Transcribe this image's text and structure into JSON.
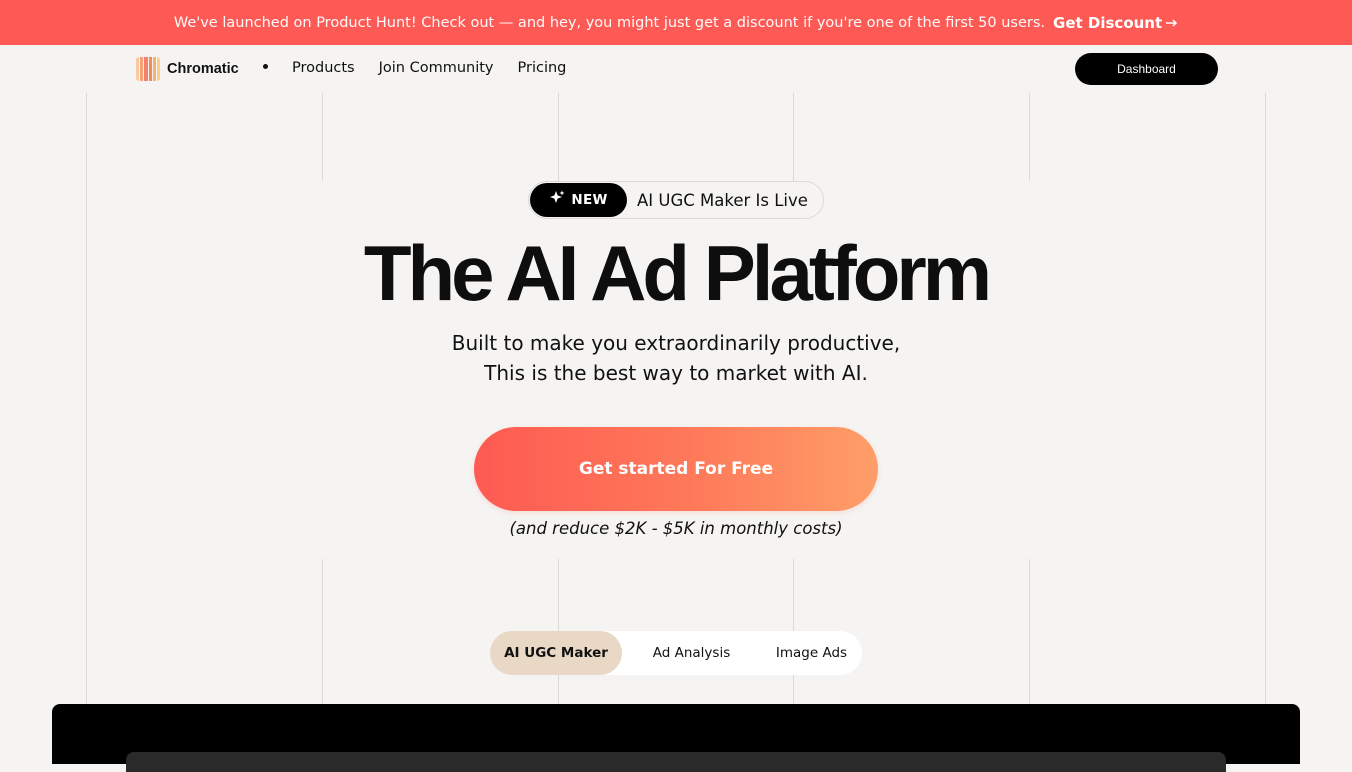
{
  "banner": {
    "message": "We've launched on Product Hunt! Check out — and hey, you might just get a discount if you're one of the first 50 users.",
    "cta_label": "Get Discount",
    "cta_icon": "arrow-right-icon",
    "background": "#fd5a55"
  },
  "nav": {
    "brand": "Chromatic",
    "links": [
      "Products",
      "Join Community",
      "Pricing"
    ],
    "dashboard_label": "Dashboard"
  },
  "hero": {
    "badge_tag": "NEW",
    "badge_icon": "sparkle-icon",
    "badge_text": "AI UGC Maker Is Live",
    "title": "The AI Ad Platform",
    "subtitle_line1": "Built to make you extraordinarily productive,",
    "subtitle_line2": "This is the best way to market with AI.",
    "cta_label": "Get started For Free",
    "cta_gradient": [
      "#fe5a52",
      "#fe9e68"
    ],
    "note": "(and reduce $2K - $5K in monthly costs)"
  },
  "tabs": {
    "items": [
      "AI UGC Maker",
      "Ad Analysis",
      "Image Ads"
    ],
    "active": "AI UGC Maker",
    "active_color": "#e9d8c5"
  }
}
